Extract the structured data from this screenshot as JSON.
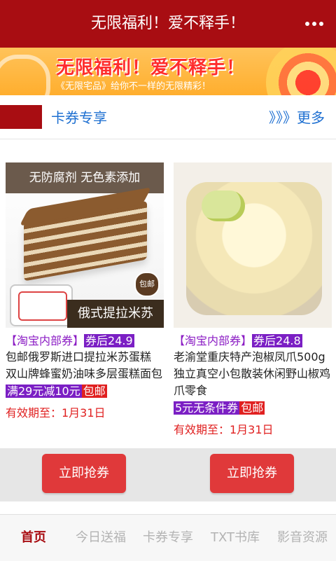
{
  "header": {
    "title": "无限福利！爱不释手！",
    "more_icon": "more-icon"
  },
  "banner": {
    "slogan": "无限福利！爱不释手！",
    "subtitle": "《无限宅品》给你不一样的无限精彩！"
  },
  "section": {
    "label": "卡券专享",
    "more": "》》》更多"
  },
  "products": [
    {
      "image": {
        "top_text": "无防腐剂  无色素添加",
        "badge": "包邮",
        "bottom_label": "俄式提拉米苏"
      },
      "tag": "【淘宝内部券】",
      "price": "券后24.9",
      "title": "包邮俄罗斯进口提拉米苏蛋糕 双山牌蜂蜜奶油味多层蛋糕面包",
      "coupon1": "满29元减10元",
      "coupon2": "包邮",
      "expire": "有效期至：1月31日",
      "button": "立即抢券"
    },
    {
      "image": {
        "top_text": "",
        "badge": "",
        "bottom_label": ""
      },
      "tag": "【淘宝内部券】",
      "price": "券后24.8",
      "title": "老渝堂重庆特产泡椒凤爪500g独立真空小包散装休闲野山椒鸡爪零食",
      "coupon1": "5元无条件券",
      "coupon2": "包邮",
      "expire": "有效期至：1月31日",
      "button": "立即抢券"
    }
  ],
  "tabs": [
    "首页",
    "今日送福",
    "卡券专享",
    "TXT书库",
    "影音资源"
  ],
  "active_tab": 0,
  "colors": {
    "brand": "#a80d12",
    "accent_purple": "#7b1fc4",
    "accent_red": "#e02020",
    "link_blue": "#1d6fd1"
  }
}
